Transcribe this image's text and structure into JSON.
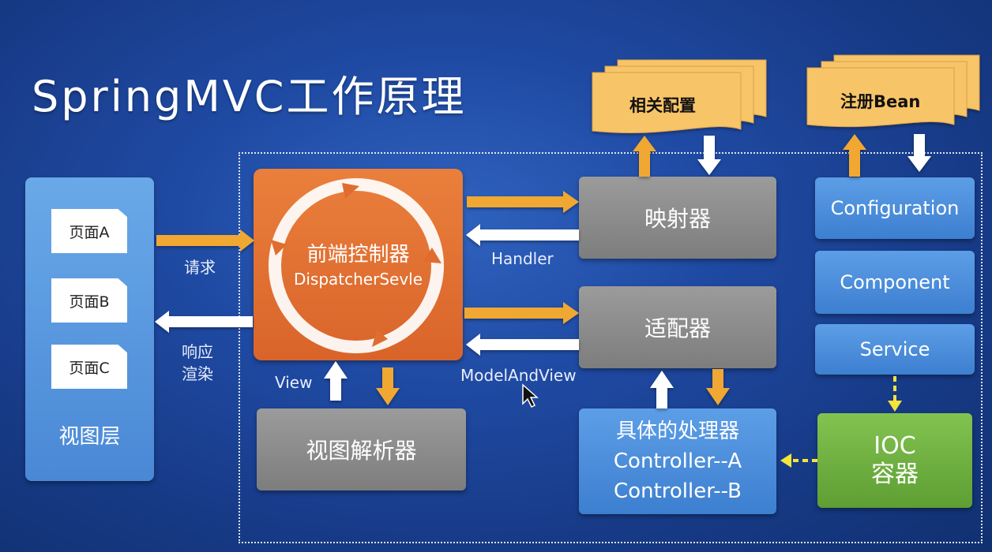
{
  "title": "SpringMVC工作原理",
  "view_layer": {
    "pages": [
      "页面A",
      "页面B",
      "页面C"
    ],
    "label": "视图层"
  },
  "request_label": "请求",
  "response_label_line1": "响应",
  "response_label_line2": "渲染",
  "front_controller": {
    "line1": "前端控制器",
    "line2": "DispatcherSevle"
  },
  "mapper": "映射器",
  "adapter": "适配器",
  "handler_label": "Handler",
  "model_and_view_label": "ModelAndView",
  "view_label": "View",
  "view_resolver": "视图解析器",
  "processor": {
    "line1": "具体的处理器",
    "line2": "Controller--A",
    "line3": "Controller--B"
  },
  "config_doc": "相关配置",
  "register_doc": "注册Bean",
  "beans": [
    "Configuration",
    "Component",
    "Service"
  ],
  "ioc": {
    "line1": "IOC",
    "line2": "容器"
  },
  "colors": {
    "background": "#1f4aa3",
    "orange_arrow": "#f0a833",
    "white_arrow": "#ffffff",
    "controller": "#e06d2f",
    "gray_box": "#8a8a8a",
    "blue_box": "#4a8adb",
    "green_box": "#6fae3f",
    "document": "#f8c467",
    "dashed_arrow": "#f5e43a"
  }
}
